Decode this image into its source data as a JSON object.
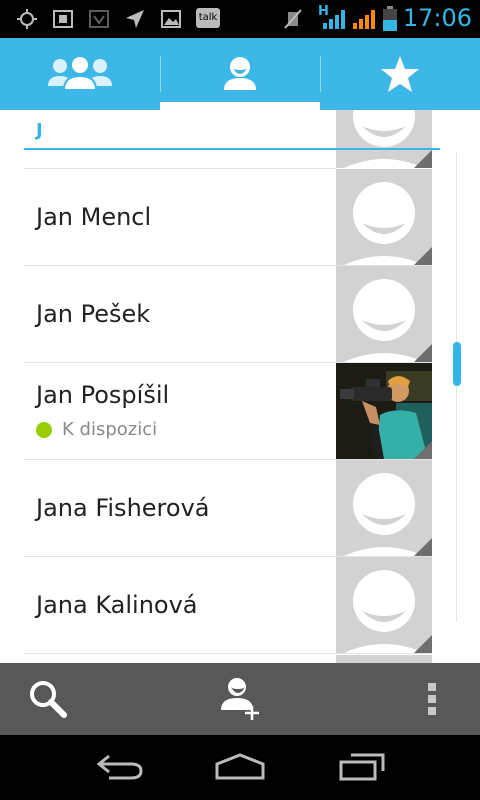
{
  "status_bar": {
    "time": "17:06",
    "talk_label": "talk",
    "network_type": "H",
    "icons": [
      "gps-icon",
      "screenshot-icon",
      "android-icon",
      "location-arrow-icon",
      "picture-icon",
      "talk-icon",
      "mute-icon",
      "signal-icon",
      "signal-icon",
      "battery-icon"
    ]
  },
  "tabs": [
    {
      "name": "groups",
      "icon": "groups-icon"
    },
    {
      "name": "contacts",
      "icon": "person-icon",
      "selected": true
    },
    {
      "name": "favorites",
      "icon": "star-icon"
    }
  ],
  "list": {
    "section_letter": "J",
    "contacts": [
      {
        "name": "Jan Mencl",
        "status": "",
        "has_photo": false
      },
      {
        "name": "Jan Pešek",
        "status": "",
        "has_photo": false
      },
      {
        "name": "Jan Pospíšil",
        "status": "K dispozici",
        "has_photo": true
      },
      {
        "name": "Jana Fisherová",
        "status": "",
        "has_photo": false
      },
      {
        "name": "Jana Kalinová",
        "status": "",
        "has_photo": false
      }
    ]
  },
  "action_bar": {
    "buttons": [
      "search-icon",
      "add-contact-icon",
      "overflow-menu-icon"
    ]
  },
  "nav_bar": {
    "buttons": [
      "back-icon",
      "home-icon",
      "recent-apps-icon"
    ]
  },
  "colors": {
    "accent": "#33b5e5",
    "tab_bar": "#3db8e6",
    "action_bar": "#585858",
    "presence_available": "#99cc00"
  }
}
